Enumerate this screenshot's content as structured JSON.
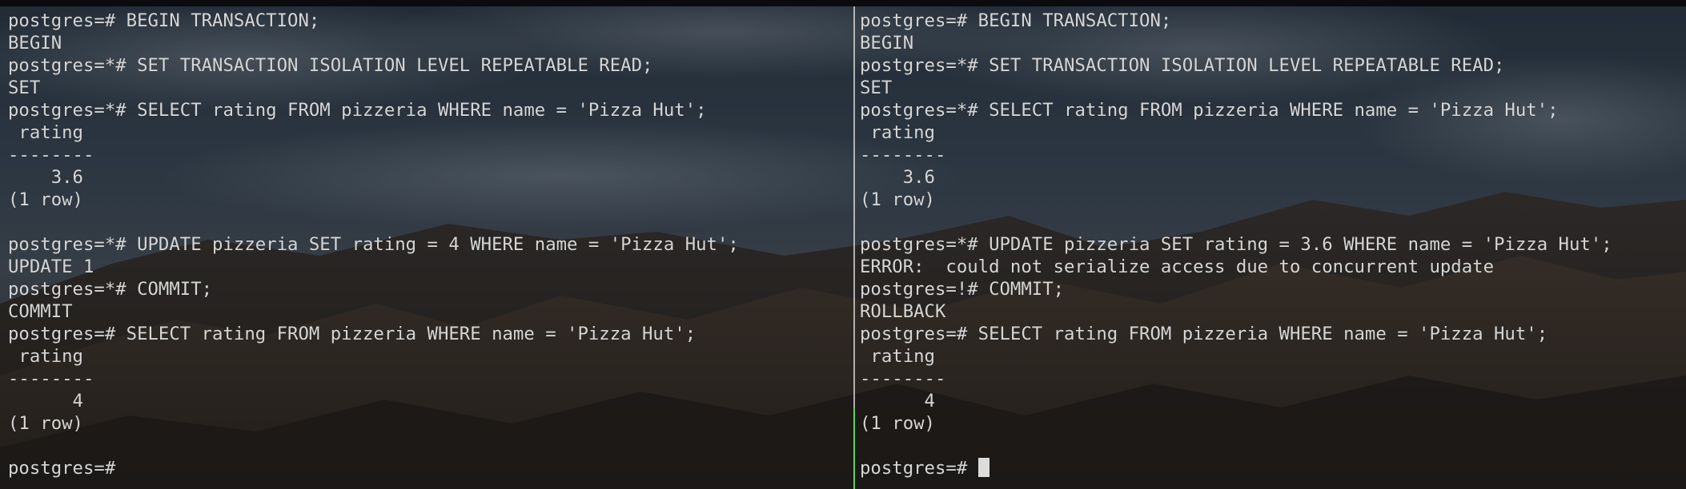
{
  "left_pane": {
    "lines": [
      "postgres=# BEGIN TRANSACTION;",
      "BEGIN",
      "postgres=*# SET TRANSACTION ISOLATION LEVEL REPEATABLE READ;",
      "SET",
      "postgres=*# SELECT rating FROM pizzeria WHERE name = 'Pizza Hut';",
      " rating",
      "--------",
      "    3.6",
      "(1 row)",
      "",
      "postgres=*# UPDATE pizzeria SET rating = 4 WHERE name = 'Pizza Hut';",
      "UPDATE 1",
      "postgres=*# COMMIT;",
      "COMMIT",
      "postgres=# SELECT rating FROM pizzeria WHERE name = 'Pizza Hut';",
      " rating",
      "--------",
      "      4",
      "(1 row)",
      "",
      "postgres=# "
    ]
  },
  "right_pane": {
    "lines": [
      "postgres=# BEGIN TRANSACTION;",
      "BEGIN",
      "postgres=*# SET TRANSACTION ISOLATION LEVEL REPEATABLE READ;",
      "SET",
      "postgres=*# SELECT rating FROM pizzeria WHERE name = 'Pizza Hut';",
      " rating",
      "--------",
      "    3.6",
      "(1 row)",
      "",
      "postgres=*# UPDATE pizzeria SET rating = 3.6 WHERE name = 'Pizza Hut';",
      "ERROR:  could not serialize access due to concurrent update",
      "postgres=!# COMMIT;",
      "ROLLBACK",
      "postgres=# SELECT rating FROM pizzeria WHERE name = 'Pizza Hut';",
      " rating",
      "--------",
      "      4",
      "(1 row)",
      "",
      "postgres=# "
    ]
  },
  "colors": {
    "text": "#d6d6d6",
    "divider": "#c9c9c9",
    "active_divider": "#5fd35a",
    "cursor": "#dcdcdc"
  }
}
